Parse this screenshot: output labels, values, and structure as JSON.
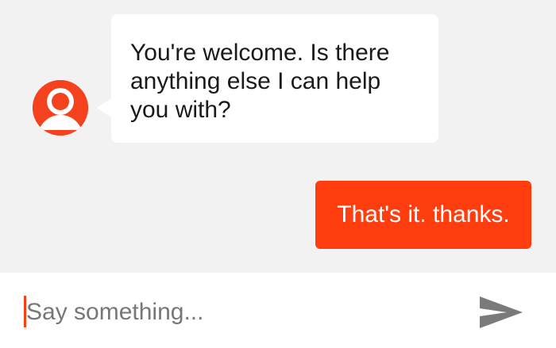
{
  "conversation": {
    "messages": [
      {
        "sender": "bot",
        "text": "You're welcome. Is there anything else I can help you with?"
      },
      {
        "sender": "user",
        "text": "That's it. thanks."
      }
    ]
  },
  "composer": {
    "placeholder": "Say something...",
    "value": ""
  },
  "icons": {
    "avatar": "user-avatar-icon",
    "send": "send-icon"
  },
  "colors": {
    "accent": "#ff3d0f",
    "background": "#f2f2f2",
    "bot_bubble": "#ffffff",
    "placeholder": "#777777",
    "send_icon": "#7a7a7a"
  }
}
